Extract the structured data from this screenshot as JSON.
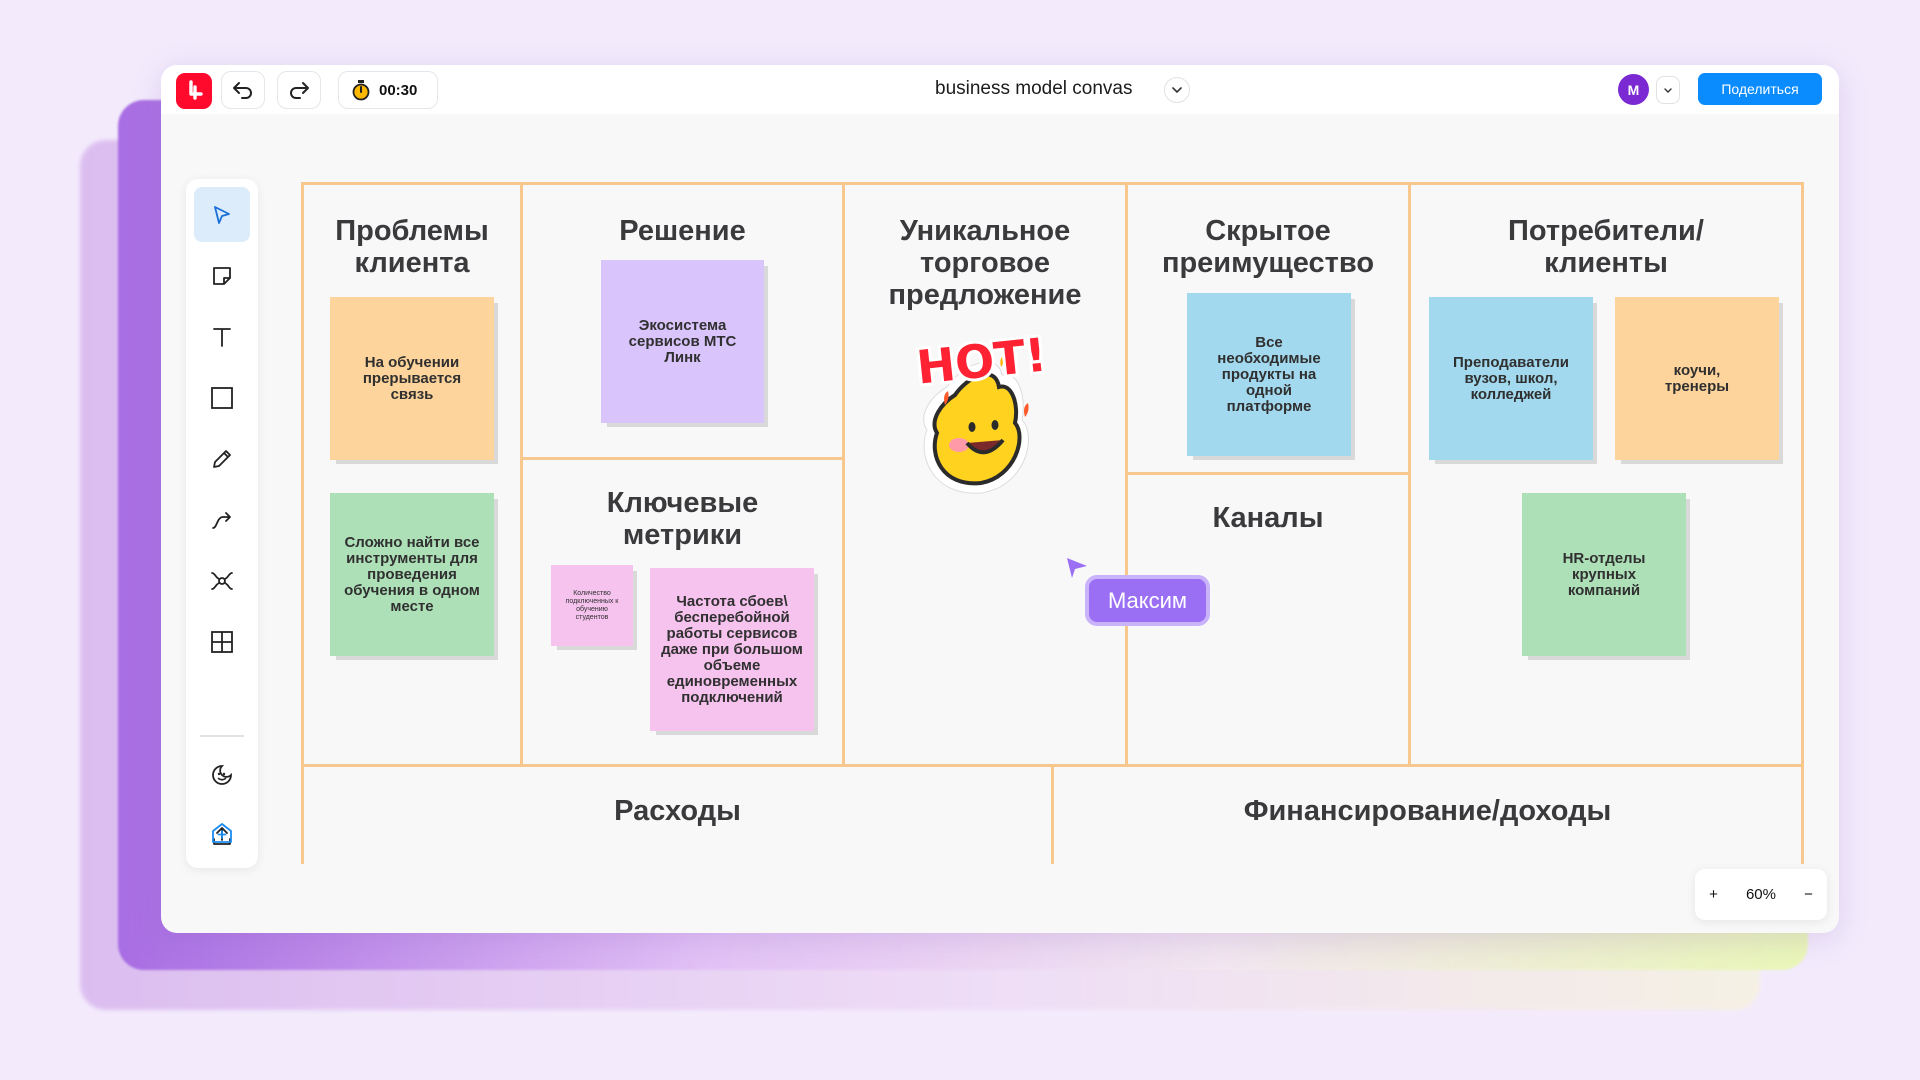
{
  "app": {
    "board_title": "business model convas",
    "timer": "00:30",
    "avatar_initial": "M",
    "share_label": "Поделиться",
    "zoom_level": "60%",
    "zoom_in": "+",
    "zoom_out": "−",
    "accent_color": "#0a8cff",
    "brand_color": "#ff0a2d"
  },
  "toolbar": {
    "tools": [
      "cursor-icon",
      "sticky-note-icon",
      "text-icon",
      "rectangle-icon",
      "pencil-icon",
      "connector-icon",
      "mindmap-icon",
      "table-icon",
      "sticker-icon",
      "upload-icon",
      "add-board-icon"
    ],
    "active": "cursor-icon"
  },
  "canvas": {
    "sections": {
      "problems": "Проблемы клиента",
      "solution": "Решение",
      "metrics": "Ключевые метрики",
      "uvp": "Уникальное торговое предложение",
      "advantage": "Скрытое преимущество",
      "channels": "Каналы",
      "customers": "Потребители/ клиенты",
      "costs": "Расходы",
      "revenue": "Финансирование/доходы"
    },
    "stickies": {
      "problem1": "На обучении прерывается связь",
      "problem2": "Сложно найти все инструменты для проведения обучения в одном месте",
      "solution1": "Экосистема сервисов МТС Линк",
      "metric_small": "Количество подключенных к обучению студентов",
      "metric_large": "Частота сбоев\\ бесперебойной работы сервисов даже при большом объеме единовременных подключений",
      "advantage1": "Все необходимые продукты на одной платформе",
      "customer1": "Преподаватели вузов, школ, колледжей",
      "customer2": "коучи, тренеры",
      "customer3": "HR-отделы крупных компаний"
    },
    "sticker_text": "HOT!",
    "collaborator_cursor": "Максим",
    "colors": {
      "orange": "#fdd49b",
      "green": "#aee0b8",
      "purple": "#d9c4fb",
      "pink": "#f6c2ee",
      "blue": "#a3d9ee",
      "grid": "#f8c78e",
      "cursor": "#9b6ff4"
    }
  }
}
